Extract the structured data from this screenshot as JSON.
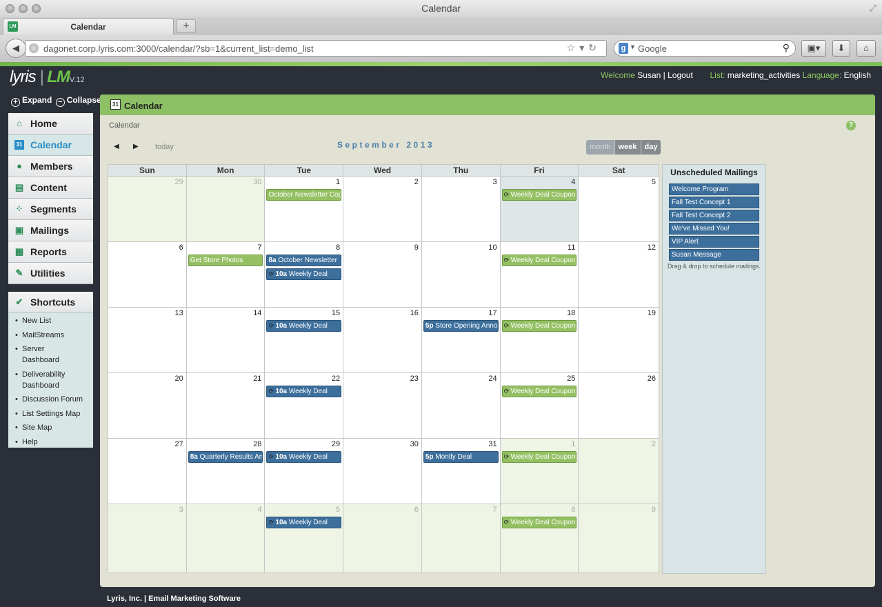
{
  "window": {
    "title": "Calendar"
  },
  "tab": {
    "label": "Calendar",
    "favicon_text": "LM"
  },
  "address": {
    "url": "dagonet.corp.lyris.com:3000/calendar/?sb=1&current_list=demo_list"
  },
  "search": {
    "placeholder": "Google"
  },
  "app": {
    "logo": "lyris",
    "logo_mark": "LM",
    "version": "V.12",
    "welcome_label": "Welcome",
    "user": "Susan",
    "logout": "Logout",
    "list_label": "List:",
    "list": "marketing_activities",
    "language_label": "Language:",
    "language": "English"
  },
  "sidebar": {
    "expand": "Expand",
    "collapse": "Collapse",
    "items": [
      {
        "label": "Home",
        "icon": "house-icon"
      },
      {
        "label": "Calendar",
        "icon": "calendar-icon"
      },
      {
        "label": "Members",
        "icon": "person-icon"
      },
      {
        "label": "Content",
        "icon": "document-icon"
      },
      {
        "label": "Segments",
        "icon": "segments-icon"
      },
      {
        "label": "Mailings",
        "icon": "mail-icon"
      },
      {
        "label": "Reports",
        "icon": "chart-icon"
      },
      {
        "label": "Utilities",
        "icon": "wrench-icon"
      }
    ],
    "shortcuts_title": "Shortcuts",
    "shortcuts": [
      "New List",
      "MailStreams",
      "Server Dashboard",
      "Deliverability Dashboard",
      "Discussion Forum",
      "List Settings Map",
      "Site Map",
      "Help"
    ]
  },
  "panel": {
    "title": "Calendar",
    "icon_text": "31",
    "breadcrumb": "Calendar",
    "today": "today",
    "month_title": "September 2013",
    "views": [
      "month",
      "week",
      "day"
    ],
    "active_view": "month",
    "weekdays": [
      "Sun",
      "Mon",
      "Tue",
      "Wed",
      "Thu",
      "Fri",
      "Sat"
    ],
    "weeks": [
      [
        {
          "d": "29",
          "other": true,
          "events": []
        },
        {
          "d": "30",
          "other": true,
          "events": []
        },
        {
          "d": "1",
          "events": [
            {
              "text": "October Newsletter Copy",
              "color": "green"
            }
          ]
        },
        {
          "d": "2",
          "events": []
        },
        {
          "d": "3",
          "events": []
        },
        {
          "d": "4",
          "today": true,
          "events": [
            {
              "text": "Weekly Deal Coupon Reminder",
              "color": "green",
              "recurring": true
            }
          ]
        },
        {
          "d": "5",
          "events": []
        }
      ],
      [
        {
          "d": "6",
          "events": []
        },
        {
          "d": "7",
          "events": [
            {
              "text": "Get Store Photos",
              "color": "green"
            }
          ]
        },
        {
          "d": "8",
          "events": [
            {
              "time": "8a",
              "text": "October Newsletter",
              "color": "blue"
            },
            {
              "time": "10a",
              "text": "Weekly Deal",
              "color": "blue",
              "recurring": true
            }
          ]
        },
        {
          "d": "9",
          "events": []
        },
        {
          "d": "10",
          "events": []
        },
        {
          "d": "11",
          "events": [
            {
              "text": "Weekly Deal Coupon Reminder",
              "color": "green",
              "recurring": true
            }
          ]
        },
        {
          "d": "12",
          "events": []
        }
      ],
      [
        {
          "d": "13",
          "events": []
        },
        {
          "d": "14",
          "events": []
        },
        {
          "d": "15",
          "events": [
            {
              "time": "10a",
              "text": "Weekly Deal",
              "color": "blue",
              "recurring": true
            }
          ]
        },
        {
          "d": "16",
          "events": []
        },
        {
          "d": "17",
          "events": [
            {
              "time": "5p",
              "text": "Store Opening Announcement",
              "color": "blue"
            }
          ]
        },
        {
          "d": "18",
          "events": [
            {
              "text": "Weekly Deal Coupon Reminder",
              "color": "green",
              "recurring": true
            }
          ]
        },
        {
          "d": "19",
          "events": []
        }
      ],
      [
        {
          "d": "20",
          "events": []
        },
        {
          "d": "21",
          "events": []
        },
        {
          "d": "22",
          "events": [
            {
              "time": "10a",
              "text": "Weekly Deal",
              "color": "blue",
              "recurring": true
            }
          ]
        },
        {
          "d": "23",
          "events": []
        },
        {
          "d": "24",
          "events": []
        },
        {
          "d": "25",
          "events": [
            {
              "text": "Weekly Deal Coupon Reminder",
              "color": "green",
              "recurring": true
            }
          ]
        },
        {
          "d": "26",
          "events": []
        }
      ],
      [
        {
          "d": "27",
          "events": []
        },
        {
          "d": "28",
          "events": [
            {
              "time": "8a",
              "text": "Quarterly Results Announcement",
              "color": "blue"
            }
          ]
        },
        {
          "d": "29",
          "events": [
            {
              "time": "10a",
              "text": "Weekly Deal",
              "color": "blue",
              "recurring": true
            }
          ]
        },
        {
          "d": "30",
          "events": []
        },
        {
          "d": "31",
          "events": [
            {
              "time": "5p",
              "text": "Montly Deal",
              "color": "blue"
            }
          ]
        },
        {
          "d": "1",
          "other": true,
          "events": [
            {
              "text": "Weekly Deal Coupon Reminder",
              "color": "green",
              "recurring": true
            }
          ]
        },
        {
          "d": "2",
          "other": true,
          "events": []
        }
      ],
      [
        {
          "d": "3",
          "other": true,
          "events": []
        },
        {
          "d": "4",
          "other": true,
          "events": []
        },
        {
          "d": "5",
          "other": true,
          "events": [
            {
              "time": "10a",
              "text": "Weekly Deal",
              "color": "blue",
              "recurring": true
            }
          ]
        },
        {
          "d": "6",
          "other": true,
          "events": []
        },
        {
          "d": "7",
          "other": true,
          "events": []
        },
        {
          "d": "8",
          "other": true,
          "events": [
            {
              "text": "Weekly Deal Coupon Reminder",
              "color": "green",
              "recurring": true
            }
          ]
        },
        {
          "d": "9",
          "other": true,
          "events": []
        }
      ]
    ]
  },
  "unscheduled": {
    "title": "Unscheduled Mailings",
    "items": [
      "Welcome Program",
      "Fall Test Concept 1",
      "Fall Test Concept 2",
      "We've Missed You!",
      "VIP Alert",
      "Susan Message"
    ],
    "hint": "Drag & drop to schedule mailings."
  },
  "footer": {
    "text": "Lyris, Inc. | Email Marketing Software"
  }
}
